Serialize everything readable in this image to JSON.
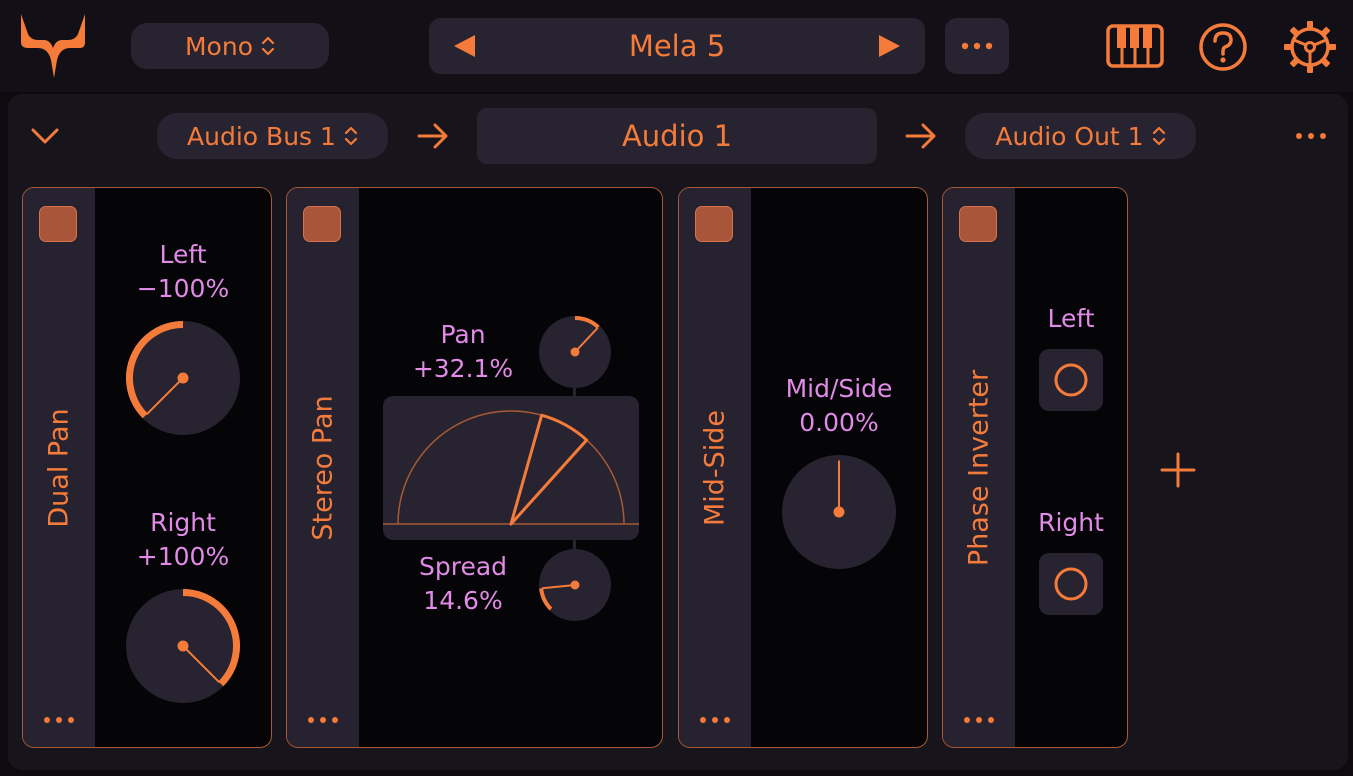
{
  "colors": {
    "accent": "#f47b3a",
    "param_label": "#e18ae8",
    "panel": "#272330",
    "module_bg": "#050406"
  },
  "topbar": {
    "logo_icon": "vee-logo-icon",
    "channel_mode": "Mono",
    "preset_name": "Mela 5",
    "icons": [
      "chevron-left-triangle-icon",
      "chevron-right-triangle-icon",
      "more-dots-icon",
      "piano-keyboard-icon",
      "help-icon",
      "settings-gear-icon"
    ]
  },
  "routing": {
    "input_bus": "Audio Bus 1",
    "track_name": "Audio 1",
    "output_bus": "Audio Out 1"
  },
  "modules": [
    {
      "name": "Dual Pan",
      "params": [
        {
          "label": "Left",
          "value": "−100%",
          "level": -1.0
        },
        {
          "label": "Right",
          "value": "+100%",
          "level": 1.0
        }
      ]
    },
    {
      "name": "Stereo Pan",
      "params": [
        {
          "label": "Pan",
          "value": "+32.1%",
          "level": 0.321
        },
        {
          "label": "Spread",
          "value": "14.6%",
          "level": 0.146
        }
      ]
    },
    {
      "name": "Mid-Side",
      "params": [
        {
          "label": "Mid/Side",
          "value": "0.00%",
          "level": 0.0
        }
      ]
    },
    {
      "name": "Phase Inverter",
      "params": [
        {
          "label": "Left"
        },
        {
          "label": "Right"
        }
      ]
    }
  ]
}
